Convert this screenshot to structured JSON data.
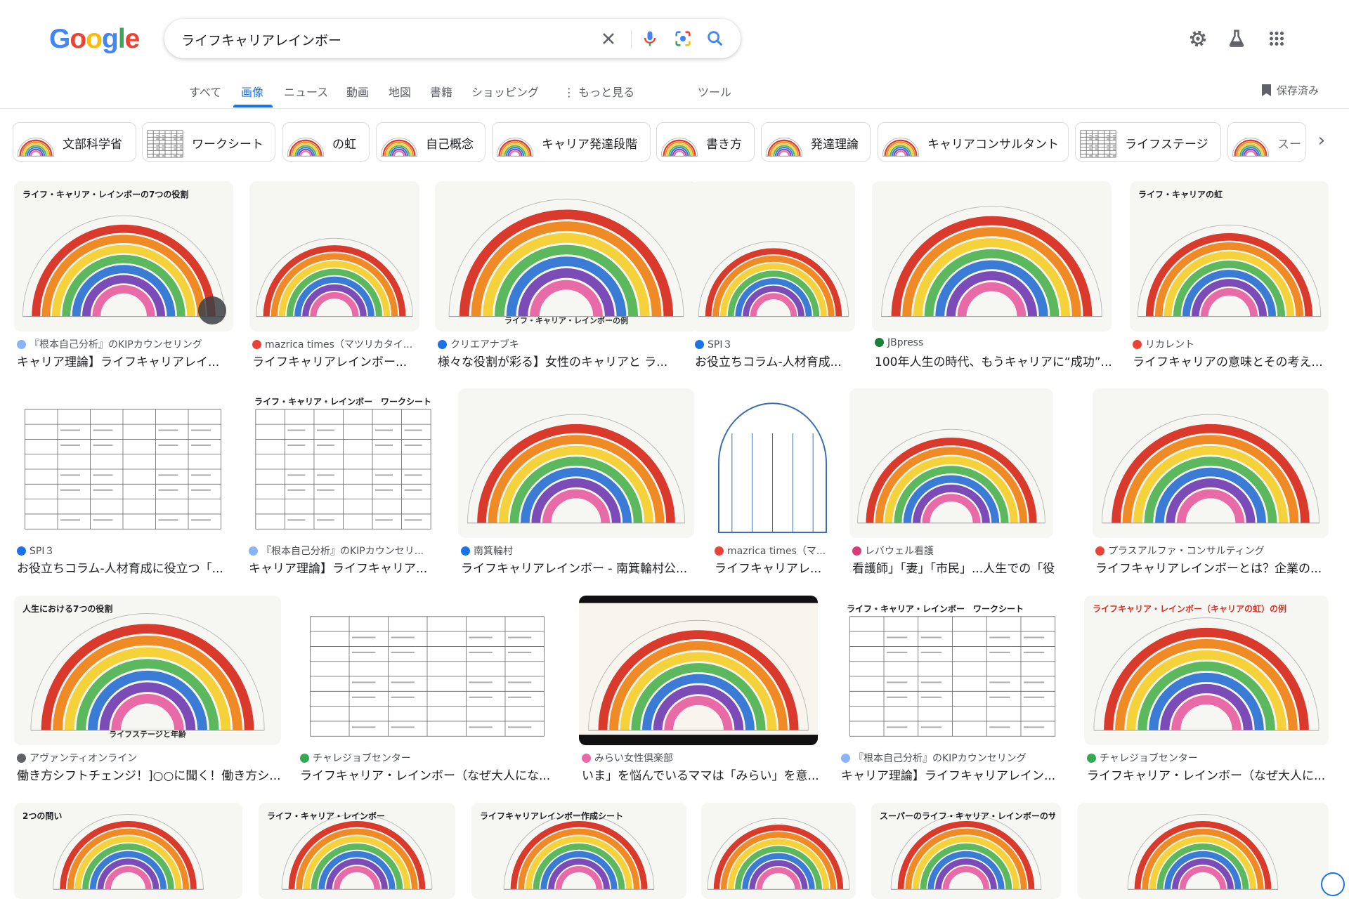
{
  "logo": {
    "text": "Google"
  },
  "search": {
    "query": "ライフキャリアレインボー"
  },
  "icons": {
    "clear": "close-icon",
    "voice": "microphone-icon",
    "lens": "lens-icon",
    "search": "search-icon",
    "settings": "gear-icon",
    "labs": "flask-icon",
    "apps": "grid-icon"
  },
  "tabs": [
    {
      "label": "すべて"
    },
    {
      "label": "画像"
    },
    {
      "label": "ニュース"
    },
    {
      "label": "動画"
    },
    {
      "label": "地図"
    },
    {
      "label": "書籍"
    },
    {
      "label": "ショッピング"
    },
    {
      "label": "もっと見る"
    },
    {
      "label": "ツール"
    }
  ],
  "saved": {
    "label": "保存済み"
  },
  "chips": [
    {
      "label": "文部科学省"
    },
    {
      "label": "ワークシート"
    },
    {
      "label": "の虹"
    },
    {
      "label": "自己概念"
    },
    {
      "label": "キャリア発達段階"
    },
    {
      "label": "書き方"
    },
    {
      "label": "発達理論"
    },
    {
      "label": "キャリアコンサルタント"
    },
    {
      "label": "ライフステージ"
    },
    {
      "label": "スー"
    }
  ],
  "results": [
    {
      "source": "『根本自己分析』のKIPカウンセリング",
      "title": "キャリア理論】ライフキャリアレイ...",
      "thumb_title": "ライフ・キャリア・レインボーの7つの役割"
    },
    {
      "source": "mazrica times（マツリカタイ...",
      "title": "ライフキャリアレインボー..."
    },
    {
      "source": "クリエアナブキ",
      "title": "様々な役割が彩る】女性のキャリアと ラ...",
      "thumb_caption": "ライフ・キャリア・レインボーの例"
    },
    {
      "source": "SPI３",
      "title": "お役立ちコラム-人材育成..."
    },
    {
      "source": "JBpress",
      "title": "100年人生の時代、もうキャリアに“成功”..."
    },
    {
      "source": "リカレント",
      "title": "ライフキャリアの意味とその考え...",
      "thumb_title": "ライフ・キャリアの虹"
    },
    {
      "source": "SPI３",
      "title": "お役立ちコラム-人材育成に役立つ「..."
    },
    {
      "source": "『根本自己分析』のKIPカウンセリ...",
      "title": "キャリア理論】ライフキャリア...",
      "thumb_title": "ライフ・キャリア・レインボー　ワークシート"
    },
    {
      "source": "南箕輪村",
      "title": "ライフキャリアレインボー - 南箕輪村公..."
    },
    {
      "source": "mazrica times（マ...",
      "title": "ライフキャリアレ..."
    },
    {
      "source": "レバウェル看護",
      "title": "看護師」「妻」「市民」...人生での「役..."
    },
    {
      "source": "プラスアルファ・コンサルティング",
      "title": "ライフキャリアレインボーとは？企業の..."
    },
    {
      "source": "アヴァンティオンライン",
      "title": "働き方シフトチェンジ！]○○に聞く！働き方シ...",
      "thumb_title": "人生における7つの役割",
      "thumb_caption": "ライフステージと年齢"
    },
    {
      "source": "チャレジョブセンター",
      "title": "ライフキャリア・レインボー（なぜ大人にな..."
    },
    {
      "source": "みらい女性倶楽部",
      "title": "いま」を悩んでいるママは「みらい」を意..."
    },
    {
      "source": "『根本自己分析』のKIPカウンセリング",
      "title": "キャリア理論】ライフキャリアレイン...",
      "thumb_title": "ライフ・キャリア・レインボー　ワークシート"
    },
    {
      "source": "チャレジョブセンター",
      "title": "ライフキャリア・レインボー（なぜ大人に...",
      "thumb_title": "ライフキャリア・レインボー（キャリアの虹）の例"
    },
    {
      "thumb_title": "2つの問い"
    },
    {
      "thumb_title": "ライフ・キャリア・レインボー"
    },
    {
      "thumb_title": "ライフキャリアレインボー作成シート"
    },
    {},
    {
      "thumb_title": "スーパーのライフ・キャリア・レインボーのサンプル"
    },
    {}
  ],
  "colors": {
    "accent": "#1a73e8",
    "rainbow": [
      "#d93a2b",
      "#f08a24",
      "#f5d23a",
      "#5cb85c",
      "#3a7bd5",
      "#7b4bb8",
      "#e86aa6"
    ]
  }
}
